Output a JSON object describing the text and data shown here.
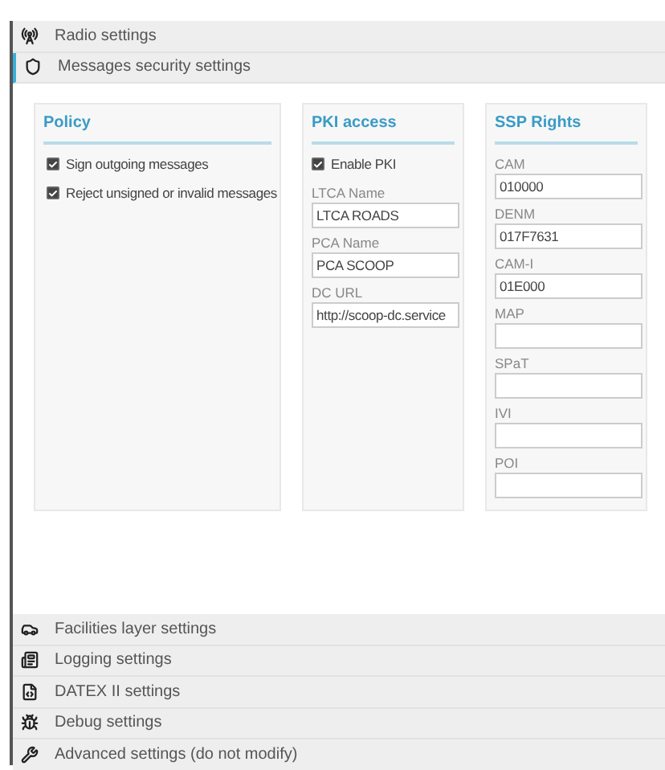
{
  "sections": [
    {
      "kind": "radio",
      "label": "Radio settings",
      "expanded": false
    },
    {
      "kind": "shield",
      "label": "Messages security settings",
      "expanded": true,
      "panels": [
        {
          "title": "Policy",
          "items": [
            {
              "kind": "checkbox",
              "label": "Sign outgoing messages",
              "checked": true
            },
            {
              "kind": "checkbox",
              "label": "Reject unsigned or invalid messages",
              "checked": true
            }
          ]
        },
        {
          "title": "PKI access",
          "items": [
            {
              "kind": "checkbox",
              "label": "Enable PKI",
              "checked": true
            },
            {
              "kind": "field",
              "label": "LTCA Name",
              "value": "LTCA ROADS"
            },
            {
              "kind": "field",
              "label": "PCA Name",
              "value": "PCA SCOOP"
            },
            {
              "kind": "field",
              "label": "DC URL",
              "value": "http://scoop-dc.service"
            }
          ]
        },
        {
          "title": "SSP Rights",
          "items": [
            {
              "kind": "field",
              "label": "CAM",
              "value": "010000"
            },
            {
              "kind": "field",
              "label": "DENM",
              "value": "017F7631"
            },
            {
              "kind": "field",
              "label": "CAM-I",
              "value": "01E000"
            },
            {
              "kind": "field",
              "label": "MAP"
            },
            {
              "kind": "field",
              "label": "SPaT"
            },
            {
              "kind": "field",
              "label": "IVI"
            },
            {
              "kind": "field",
              "label": "POI"
            }
          ]
        }
      ]
    },
    {
      "kind": "car",
      "label": "Facilities layer settings",
      "expanded": false
    },
    {
      "kind": "log",
      "label": "Logging settings",
      "expanded": false
    },
    {
      "kind": "code",
      "label": "DATEX II settings",
      "expanded": false
    },
    {
      "kind": "bug",
      "label": "Debug settings",
      "expanded": false
    },
    {
      "kind": "wrench",
      "label": "Advanced settings (do not modify)",
      "expanded": false
    }
  ]
}
